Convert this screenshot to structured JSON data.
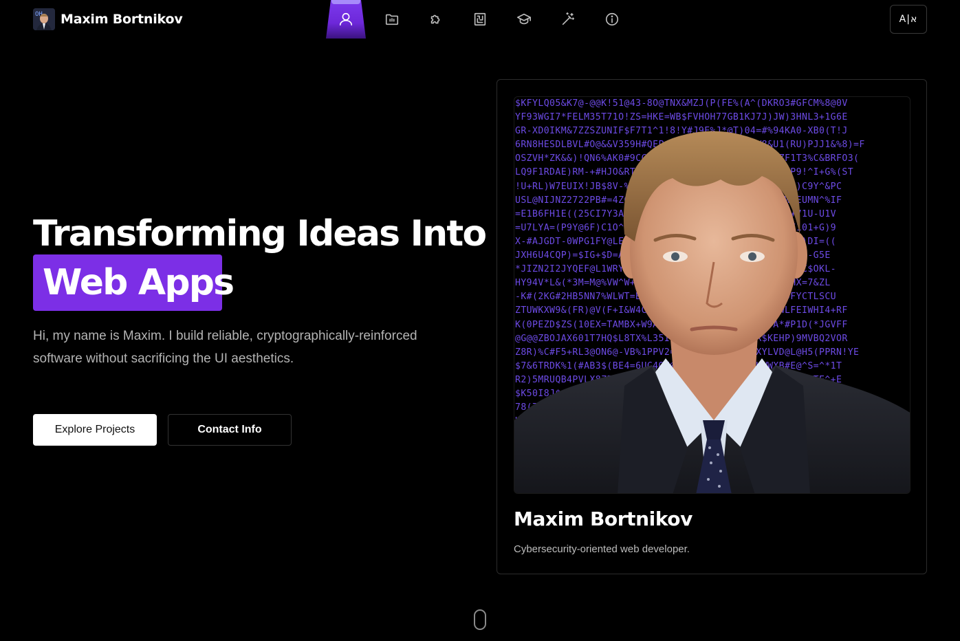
{
  "header": {
    "brand_name": "Maxim Bortnikov",
    "nav_icons": [
      "user-icon",
      "folder-icon",
      "puzzle-icon",
      "circuit-board-icon",
      "graduation-cap-icon",
      "magic-wand-icon",
      "info-icon"
    ],
    "active_index": 0,
    "language_toggle": "A|א"
  },
  "hero": {
    "title_line1": "Transforming Ideas Into",
    "title_highlight": "Web Apps",
    "description": "Hi, my name is Maxim. I build reliable, cryptographically-reinforced software without sacrificing the UI aesthetics.",
    "primary_button": "Explore Projects",
    "secondary_button": "Contact Info"
  },
  "profile_card": {
    "name": "Maxim Bortnikov",
    "role": "Cybersecurity-oriented web developer.",
    "matrix_lines": [
      "$KFYLQ05&K7@-@@K!51@43-8O@TNX&MZJ(P(FE%(A^(DKRO3#GFCM%8@0V",
      "YF93WGI7*FELM35T71O!ZS=HKE=WB$FVHOH77GB1KJ7J)JW)3HNL3+1G6E",
      "GR-XD0IKM&7ZZSZUNIF$F7T1^1!8!Y#J9E%J*@T)04=#%94KA0-XB0(T!J",
      "6RN8HESDLBVL#O@&&V359H#QEP4ADW!C%@2PEIX-FBW8&U1(RU)PJJ1&%8)=F",
      "OSZVH*ZK&&)!QN6%AK0#9CC7T1V=9G8%C%$2WKQBA*+)-EZF1T3%C&BRFO3(",
      "LQ9F1RDAE)RM-+#HJO&RTZ%CT9$%*#GVB6%UJMVKUW2GNRY$P9!^I+G%(ST",
      "!U+RL)W7EUIX!JB$8V-%W$A3#H4$+YWX!6VD8HSZWV%DM&X)N)C9Y^&PC",
      "USL@NIJNZ2722PB#=4ZGB6^&1S$+G77V@6B0L9X+S&C*OWUWBEUMN^%IF",
      "=E1B6FH1E((25CI7Y3A+B2L3=#DNJM0JA^U@1C+WE&)SBMEL+71U-U1V",
      "=U7LYA=(P9Y@6F)C1O^S@PI2K8T-A1*4E4%5*KOOD%9BQ^@SE101+G)9",
      "X-#AJGDT-0WPG1FY@LE61)ZD+8H8-J6O^O4@ZP8$0^%5LY9A7S)DI=((",
      "JXH6U4CQP)=$IG+$D=A!9JB-0JS=6(W37F6G+$ET*27=(WR-K5S-G5E",
      "*JIZN2I2JYQEF@L1WRYR)EUOMR%W#M$Q!WJF2-#A=H%&Z9=Y05C$OKL-",
      "HY94V*L&(*3M=M@%VW^W+WAGC@5%+XX1QY%E83BUND)JIS-JHX=7&ZL",
      "-K#(2KG#2HB5NN7%WLWT=BCF7AI%$$OU8%S1MSE8&F8EIN+9FYCTLSCU",
      "ZTUWKXW9&(FR)@V(F+I&W4CX#@6$O#4QJ&U@I&B*C$A8A@WLFEIWHI4+RF",
      "K(0PEZD$ZS(10EX=TAMBX+W9AS@K1EKU*JJIVWC&H=N#VA*#P1D(*JGVFF",
      "@G@@ZBOJAX601T7HQ$L8TX%L35IY8=DRN!F9O8L923R$KEHP)9MVBQ2VOR",
      "Z8R)%C#F5+RL3@ON6@-VB%1PPV2=Q9(J33*$W!)!KZXYLVD@L@H5(PPRN!YE",
      "$7&6TRDK%1(#AB3$(BE4=6UC4QN@X8@*5OI*2SIX5XHWWXB#E@^S=^*1T",
      "R2)5MRUQB4PVLX8ZES%L6(@MCA4M7Q@6O$Y3&+C+Q%(7YT@B=S)FTE^+E",
      "$K50I8J$@1QBLNY%JD(N7E4&+W55T2G$Z%=5WV+NJJ59RCWPEP=L",
      "78(7@HLK!VO(9H@1%-VJ3OL+OX0+0JT6RR!^ZG@D*&P=U1172",
      "K)4U9%9U3R#F3+KYLJLXG9A%6Q&%F0@FNEV^&T!3ZFE4"
    ]
  }
}
